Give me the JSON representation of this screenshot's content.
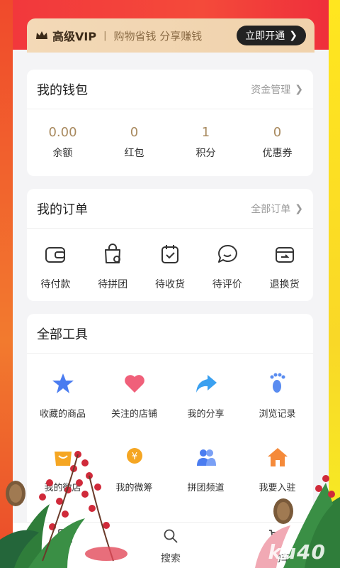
{
  "vip": {
    "title": "高级VIP",
    "separator": "|",
    "subtitle": "购物省钱 分享赚钱",
    "button": "立即开通"
  },
  "wallet": {
    "title": "我的钱包",
    "link": "资金管理",
    "items": [
      {
        "value": "0.00",
        "label": "余额"
      },
      {
        "value": "0",
        "label": "红包"
      },
      {
        "value": "1",
        "label": "积分"
      },
      {
        "value": "0",
        "label": "优惠券"
      }
    ]
  },
  "orders": {
    "title": "我的订单",
    "link": "全部订单",
    "items": [
      {
        "label": "待付款",
        "icon": "wallet-icon"
      },
      {
        "label": "待拼团",
        "icon": "group-bag-icon"
      },
      {
        "label": "待收货",
        "icon": "calendar-check-icon"
      },
      {
        "label": "待评价",
        "icon": "comment-icon"
      },
      {
        "label": "退换货",
        "icon": "return-icon"
      }
    ]
  },
  "tools": {
    "title": "全部工具",
    "items": [
      {
        "label": "收藏的商品",
        "icon": "star-icon",
        "color": "#4a7cf0"
      },
      {
        "label": "关注的店铺",
        "icon": "heart-icon",
        "color": "#f0607a"
      },
      {
        "label": "我的分享",
        "icon": "share-icon",
        "color": "#3aa0f0"
      },
      {
        "label": "浏览记录",
        "icon": "footprint-icon",
        "color": "#5a8cf0"
      },
      {
        "label": "我的微店",
        "icon": "shop-icon",
        "color": "#f5a623"
      },
      {
        "label": "我的微筹",
        "icon": "coin-icon",
        "color": "#f5a623"
      },
      {
        "label": "拼团频道",
        "icon": "people-icon",
        "color": "#4a7cf0"
      },
      {
        "label": "我要入驻",
        "icon": "house-icon",
        "color": "#f58a3a"
      }
    ]
  },
  "tabbar": {
    "items": [
      {
        "label": "",
        "icon": "grid-icon"
      },
      {
        "label": "搜索",
        "icon": "search-icon"
      },
      {
        "label": "购物车",
        "icon": "cart-icon"
      }
    ]
  },
  "watermark": "ku40"
}
